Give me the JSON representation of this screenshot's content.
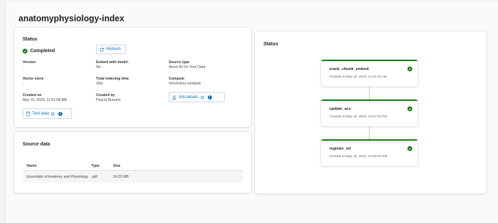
{
  "page_title": "anatomyphysiology-index",
  "status_card": {
    "title": "Status",
    "status": "Completed",
    "refresh_label": "Refresh",
    "fields": {
      "version_label": "Version",
      "version_value": "-",
      "embed_label": "Embed with model",
      "embed_value": "No",
      "source_type_label": "Source type",
      "source_type_value": "Azure AI On Your Data",
      "vector_store_label": "Vector store",
      "vector_store_value": "-",
      "indexing_time_label": "Total indexing time",
      "indexing_time_value": "18m",
      "compute_label": "Compute",
      "compute_value": "Serverless compute",
      "created_on_label": "Created on",
      "created_on_value": "May 10, 2024, 11:51:08 AM",
      "created_by_label": "Created by",
      "created_by_value": "Pascal Burume"
    },
    "job_details_label": "Job details",
    "test_data_label": "Test data"
  },
  "source_data": {
    "title": "Source data",
    "columns": [
      "Name",
      "Type",
      "Size"
    ],
    "rows": [
      {
        "name": "Essentials of Anatomy and Physiology",
        "type": ".pdf",
        "size": "24.25 MB"
      }
    ]
  },
  "pipeline": {
    "title": "Status",
    "status_color": "#107c10",
    "steps": [
      {
        "name": "crack_chunk_embed",
        "time": "Created at May 10, 2024, 11:51:10 AM"
      },
      {
        "name": "update_acs",
        "time": "Created at May 10, 2024, 12:07:20 PM"
      },
      {
        "name": "register_ml",
        "time": "Created at May 10, 2024, 12:08:29 PM"
      }
    ]
  },
  "icons": {
    "status": "check-circle-icon",
    "refresh": "refresh-icon",
    "external_link": "open-external-icon",
    "info": "info-icon",
    "test_data": "flask-icon"
  }
}
